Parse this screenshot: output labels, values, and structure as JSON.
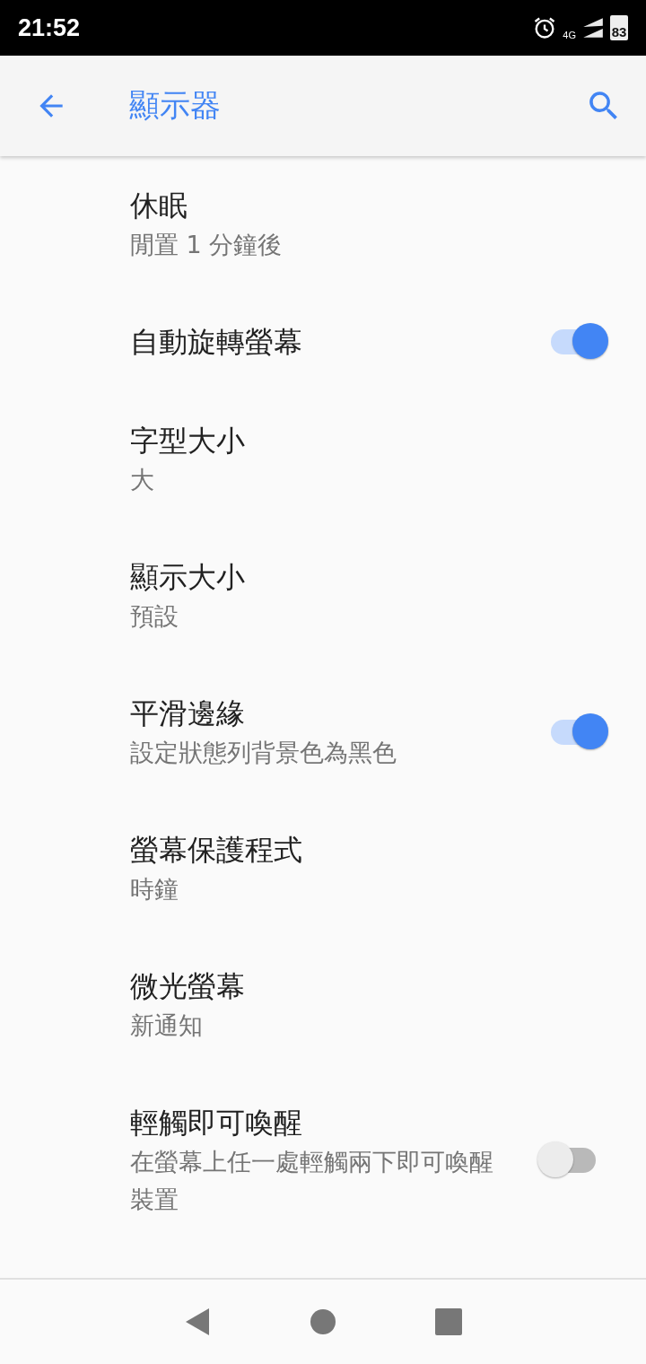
{
  "status_bar": {
    "time": "21:52",
    "network": "4G",
    "battery": "83"
  },
  "toolbar": {
    "title": "顯示器"
  },
  "settings": [
    {
      "kind": "text",
      "title": "休眠",
      "summary": "閒置 1 分鐘後"
    },
    {
      "kind": "switch",
      "title": "自動旋轉螢幕",
      "on": true
    },
    {
      "kind": "text",
      "title": "字型大小",
      "summary": "大"
    },
    {
      "kind": "text",
      "title": "顯示大小",
      "summary": "預設"
    },
    {
      "kind": "switch",
      "title": "平滑邊緣",
      "summary": "設定狀態列背景色為黑色",
      "on": true
    },
    {
      "kind": "text",
      "title": "螢幕保護程式",
      "summary": "時鐘"
    },
    {
      "kind": "text",
      "title": "微光螢幕",
      "summary": "新通知"
    },
    {
      "kind": "switch",
      "title": "輕觸即可喚醒",
      "summary": "在螢幕上任一處輕觸兩下即可喚醒裝置",
      "on": false
    }
  ]
}
